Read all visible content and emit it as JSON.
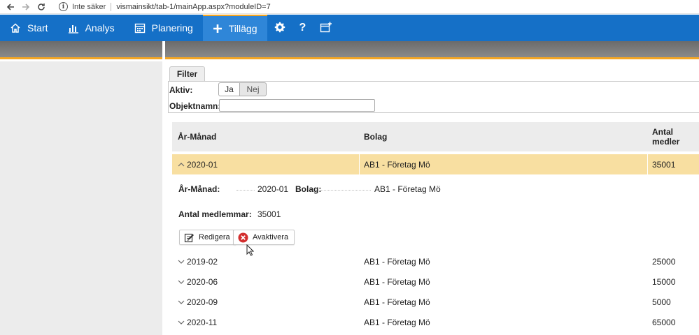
{
  "browser": {
    "security_label": "Inte säker",
    "url": "vismainsikt/tab-1/mainApp.aspx?moduleID=7"
  },
  "nav": {
    "items": [
      {
        "label": "Start",
        "icon": "home-icon"
      },
      {
        "label": "Analys",
        "icon": "bar-chart-icon"
      },
      {
        "label": "Planering",
        "icon": "calendar-icon"
      },
      {
        "label": "Tillägg",
        "icon": "plus-icon",
        "active": true
      }
    ],
    "icon_buttons": [
      "gear-icon",
      "help-icon",
      "add-calendar-icon"
    ]
  },
  "filter": {
    "tab_label": "Filter",
    "aktiv_label": "Aktiv:",
    "toggle_yes": "Ja",
    "toggle_no": "Nej",
    "toggle_selected": "Ja",
    "objektnamn_label": "Objektnamn:",
    "objektnamn_value": ""
  },
  "table": {
    "columns": [
      "År-Månad",
      "Bolag",
      "Antal medler"
    ],
    "selected_row": {
      "year_month": "2020-01",
      "company": "AB1 - Företag Mö",
      "members": "35001"
    },
    "detail": {
      "year_month_label": "År-Månad:",
      "year_month_value": "2020-01",
      "company_label": "Bolag:",
      "company_value": "AB1 - Företag Mö",
      "members_label": "Antal medlemmar:",
      "members_value": "35001",
      "edit_button": "Redigera",
      "deactivate_button": "Avaktivera"
    },
    "rows": [
      {
        "year_month": "2019-02",
        "company": "AB1 - Företag Mö",
        "members": "25000"
      },
      {
        "year_month": "2020-06",
        "company": "AB1 - Företag Mö",
        "members": "15000"
      },
      {
        "year_month": "2020-09",
        "company": "AB1 - Företag Mö",
        "members": "5000"
      },
      {
        "year_month": "2020-11",
        "company": "AB1 - Företag Mö",
        "members": "65000"
      }
    ]
  },
  "colors": {
    "nav_bg": "#1570c7",
    "nav_active": "#2f86d8",
    "accent": "#f5a623",
    "selected_row": "#f8dfa1",
    "deactivate_red": "#d32f2f"
  }
}
